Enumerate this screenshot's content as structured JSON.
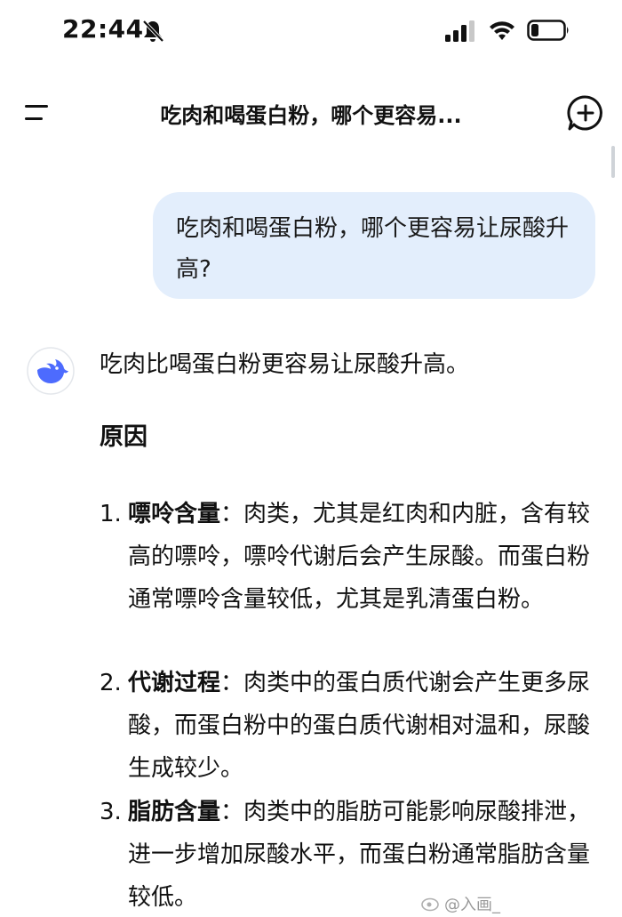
{
  "status_bar": {
    "time": "22:44"
  },
  "nav": {
    "title": "吃肉和喝蛋白粉，哪个更容易..."
  },
  "conversation": {
    "user_message": "吃肉和喝蛋白粉，哪个更容易让尿酸升高?",
    "assistant": {
      "intro": "吃肉比喝蛋白粉更容易让尿酸升高。",
      "heading": "原因",
      "reasons": [
        {
          "number": "1.",
          "title": "嘌呤含量",
          "text": "：肉类，尤其是红肉和内脏，含有较高的嘌呤，嘌呤代谢后会产生尿酸。而蛋白粉通常嘌呤含量较低，尤其是乳清蛋白粉。"
        },
        {
          "number": "2.",
          "title": "代谢过程",
          "text": "：肉类中的蛋白质代谢会产生更多尿酸，而蛋白粉中的蛋白质代谢相对温和，尿酸生成较少。"
        },
        {
          "number": "3.",
          "title": "脂肪含量",
          "text": "：肉类中的脂肪可能影响尿酸排泄，进一步增加尿酸水平，而蛋白粉通常脂肪含量较低。"
        }
      ]
    }
  },
  "watermark": "@入画_",
  "icons": {
    "menu": "menu-icon",
    "new_chat": "new-chat-icon",
    "avatar": "whale-logo-icon"
  },
  "colors": {
    "user_bubble": "#e3eefc",
    "avatar_blue": "#4d6bfe"
  }
}
